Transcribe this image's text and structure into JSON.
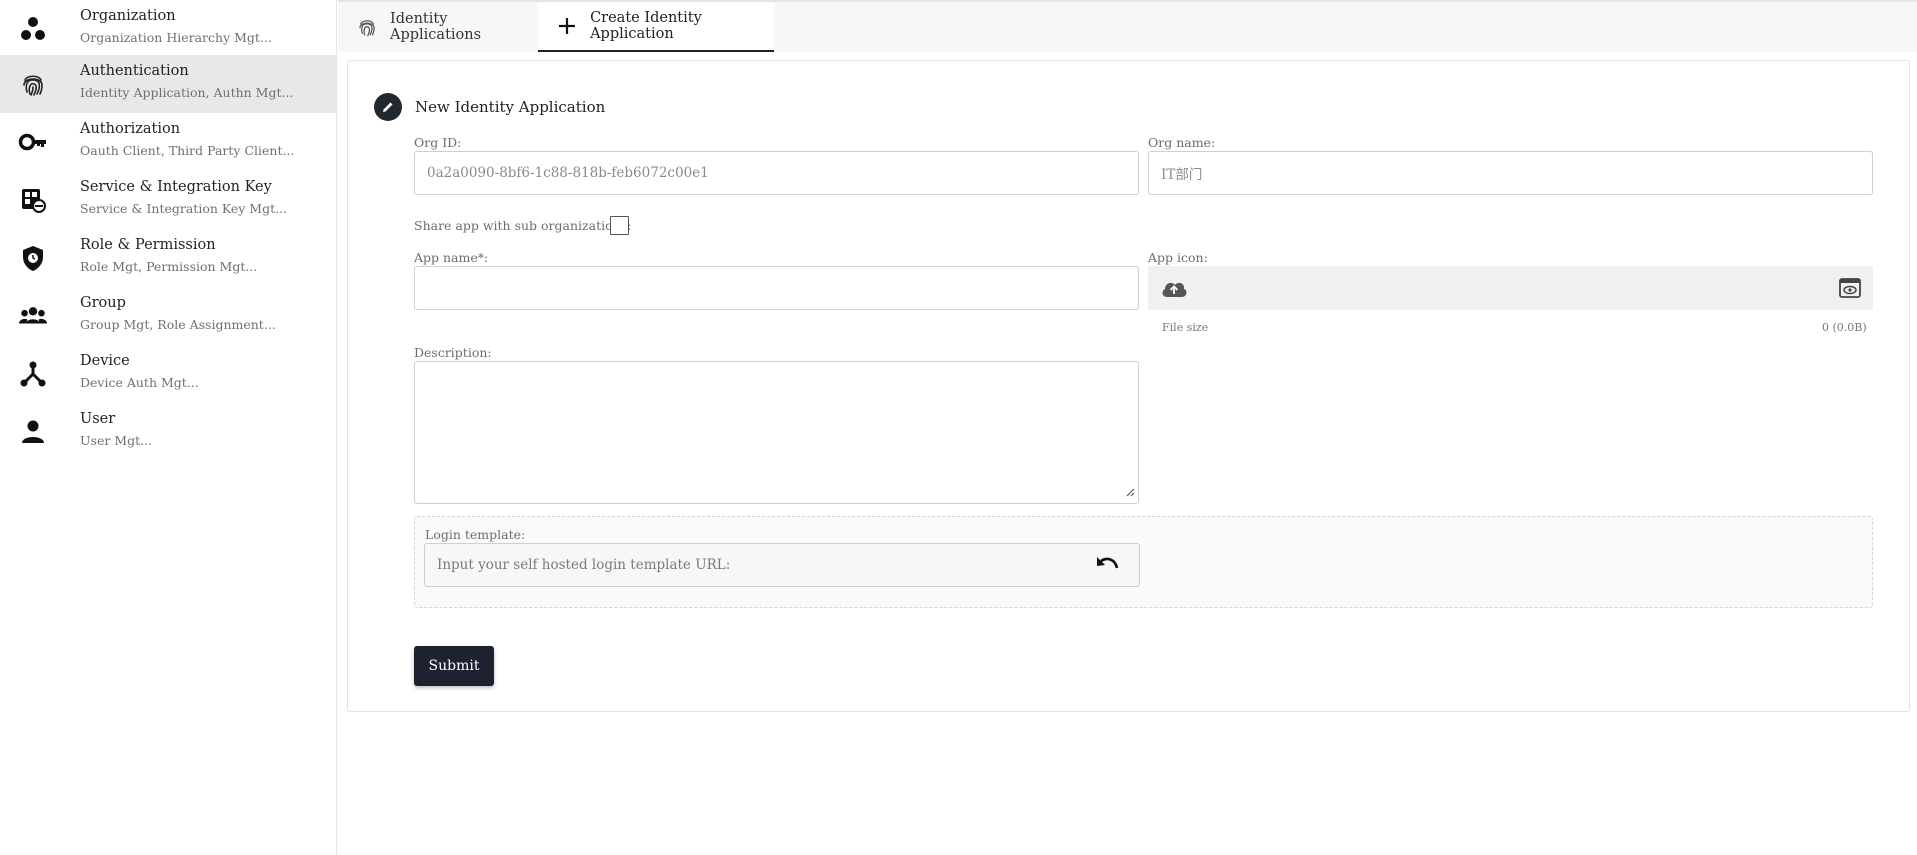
{
  "sidebar": {
    "items": [
      {
        "title": "Organization",
        "subtitle": "Organization Hierarchy Mgt...",
        "icon": "organization-icon",
        "active": false
      },
      {
        "title": "Authentication",
        "subtitle": "Identity Application, Authn Mgt...",
        "icon": "fingerprint-icon",
        "active": true
      },
      {
        "title": "Authorization",
        "subtitle": "Oauth Client, Third Party Client...",
        "icon": "key-icon",
        "active": false
      },
      {
        "title": "Service & Integration Key",
        "subtitle": "Service & Integration Key Mgt...",
        "icon": "service-key-icon",
        "active": false
      },
      {
        "title": "Role & Permission",
        "subtitle": "Role Mgt, Permission Mgt...",
        "icon": "shield-icon",
        "active": false
      },
      {
        "title": "Group",
        "subtitle": "Group Mgt, Role Assignment...",
        "icon": "group-icon",
        "active": false
      },
      {
        "title": "Device",
        "subtitle": "Device Auth Mgt...",
        "icon": "device-icon",
        "active": false
      },
      {
        "title": "User",
        "subtitle": "User Mgt...",
        "icon": "user-icon",
        "active": false
      }
    ]
  },
  "tabs": [
    {
      "label": "Identity Applications",
      "icon": "fingerprint-icon",
      "active": false
    },
    {
      "label": "Create Identity Application",
      "icon": "plus-icon",
      "active": true
    }
  ],
  "form": {
    "title": "New Identity Application",
    "org_id_label": "Org ID:",
    "org_id_value": "0a2a0090-8bf6-1c88-818b-feb6072c00e1",
    "org_name_label": "Org name:",
    "org_name_value": "IT部门",
    "share_label": "Share app with sub organizations:",
    "share_checked": false,
    "app_name_label": "App name*:",
    "app_name_value": "",
    "app_icon_label": "App icon:",
    "file_size_label": "File size",
    "file_size_value": "0 (0.0B)",
    "description_label": "Description:",
    "description_value": "",
    "login_template_label": "Login template:",
    "login_template_placeholder": "Input your self  hosted login template URL:",
    "submit_label": "Submit"
  },
  "colors": {
    "accent": "#1e2230",
    "active_sidebar_bg": "#e8e8e8"
  }
}
